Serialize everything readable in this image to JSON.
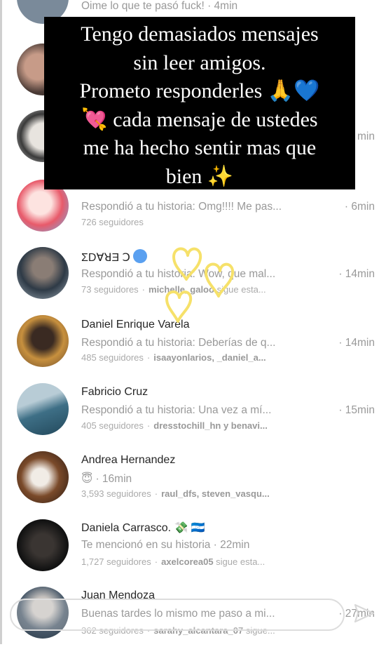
{
  "overlay": {
    "lines": [
      "Tengo demasiados mensajes",
      "sin leer amigos.",
      "Prometo responderles 🙏💙",
      "💘 cada mensaje de ustedes",
      "me ha hecho sentir mas que",
      "bien ✨"
    ]
  },
  "top_partial": {
    "preview": "Oime lo que te pasó fuck! · 4min",
    "time_right": "min"
  },
  "rows": [
    {
      "name": "",
      "preview": "Respondió a tu historia: Omg!!!! Me pas...",
      "time": "· 6min",
      "followers": "726 seguidores",
      "mutual": "",
      "mutual_rest": ""
    },
    {
      "name": "ΣDⱯꓤƎ Ↄ",
      "preview": "Respondió a tu historia: Wow, que mal...",
      "time": "· 14min",
      "followers": "73 seguidores",
      "mutual": "michelle_galoo",
      "mutual_rest": "sigue esta..."
    },
    {
      "name": "Daniel Enrique Varela",
      "preview": "Respondió a tu historia: Deberías de q...",
      "time": "· 14min",
      "followers": "485 seguidores",
      "mutual": "isaayonlarios, _daniel_a...",
      "mutual_rest": ""
    },
    {
      "name": "Fabricio Cruz",
      "preview": "Respondió a tu historia: Una vez a mí...",
      "time": "· 15min",
      "followers": "405 seguidores",
      "mutual": "dresstochill_hn y benavi...",
      "mutual_rest": ""
    },
    {
      "name": "Andrea Hernandez",
      "preview": "😇 · 16min",
      "time": "",
      "followers": "3,593 seguidores",
      "mutual": "raul_dfs, steven_vasqu...",
      "mutual_rest": ""
    },
    {
      "name": "Daniela Carrasco. 💸 🇭🇳",
      "preview": "Te mencionó en su historia · 22min",
      "time": "",
      "followers": "1,727 seguidores",
      "mutual": "axelcorea05",
      "mutual_rest": "sigue esta..."
    },
    {
      "name": "Juan Mendoza",
      "preview": "",
      "time": "",
      "followers": "362 seguidores",
      "mutual": "sarahy_alcantara_07",
      "mutual_rest": "sigue..."
    }
  ],
  "reply": {
    "text": "Buenas tardes lo mismo me paso a mi...",
    "time": "· 27min"
  },
  "colors": {
    "overlay_bg": "#000000",
    "muted_text": "#999999",
    "heart_yellow": "#f6e16a"
  }
}
